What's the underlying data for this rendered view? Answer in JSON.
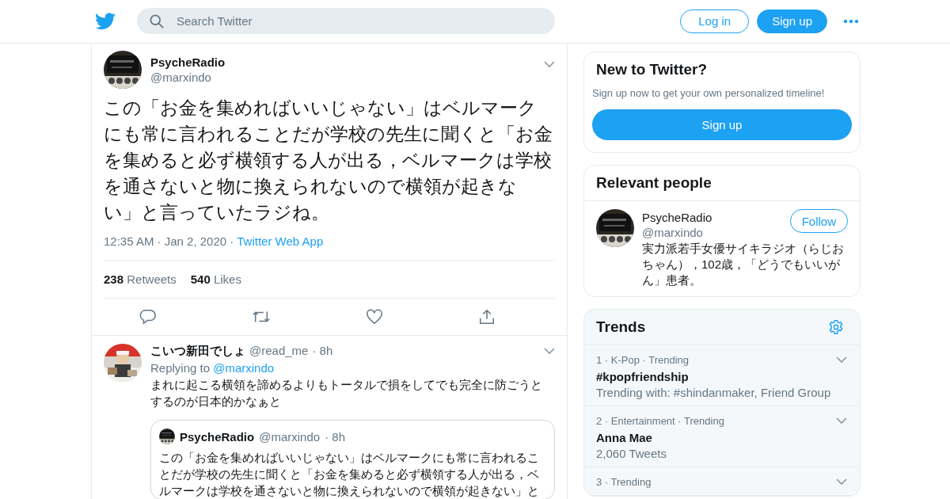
{
  "header": {
    "search": {
      "placeholder": "Search Twitter"
    },
    "login": "Log in",
    "signup": "Sign up"
  },
  "tweet": {
    "name": "PsycheRadio",
    "handle": "@marxindo",
    "text": "この「お金を集めればいいじゃない」はベルマークにも常に言われることだが学校の先生に聞くと「お金を集めると必ず横領する人が出る，ベルマークは学校を通さないと物に換えられないので横領が起きない」と言っていたラジね。",
    "meta": "12:35 AM · Jan 2, 2020 ·",
    "source": "Twitter Web App",
    "stats": [
      {
        "count": "238",
        "label": "Retweets"
      },
      {
        "count": "540",
        "label": "Likes"
      }
    ],
    "actions": [
      {
        "kind": "reply"
      },
      {
        "kind": "retweet"
      },
      {
        "kind": "like"
      },
      {
        "kind": "share"
      }
    ]
  },
  "reply": {
    "name": "こいつ新田でしょ",
    "handle": "@read_me",
    "time": "· 8h",
    "replying_to": "Replying to",
    "replying_handle": "@marxindo",
    "text": "まれに起こる横領を諦めるよりもトータルで損をしてでも完全に防ごうとするのが日本的かなぁと",
    "quote": {
      "name": "PsycheRadio",
      "handle": "@marxindo",
      "time": "· 8h",
      "text": "この「お金を集めればいいじゃない」はベルマークにも常に言われることだが学校の先生に聞くと「お金を集めると必ず横領する人が出る，ベルマークは学校を通さないと物に換えられないので横領が起きない」と"
    }
  },
  "new_to_twitter": {
    "title": "New to Twitter?",
    "text": "Sign up now to get your own personalized timeline!",
    "button": "Sign up"
  },
  "relevant_people": {
    "title": "Relevant people",
    "people": [
      {
        "name": "PsycheRadio",
        "handle": "@marxindo",
        "button": "Follow",
        "bio": "実力派若手女優サイキラジオ（らじおちゃん），102歳，「どうでもいいがん」患者。"
      }
    ]
  },
  "trends": {
    "title": "Trends",
    "items": [
      {
        "meta": "1 · K-Pop · Trending",
        "name": "#kpopfriendship",
        "detail": "Trending with: #shindanmaker, Friend Group"
      },
      {
        "meta": "2 · Entertainment · Trending",
        "name": "Anna Mae",
        "detail": "2,060 Tweets"
      },
      {
        "meta": "3 · Trending"
      }
    ]
  }
}
